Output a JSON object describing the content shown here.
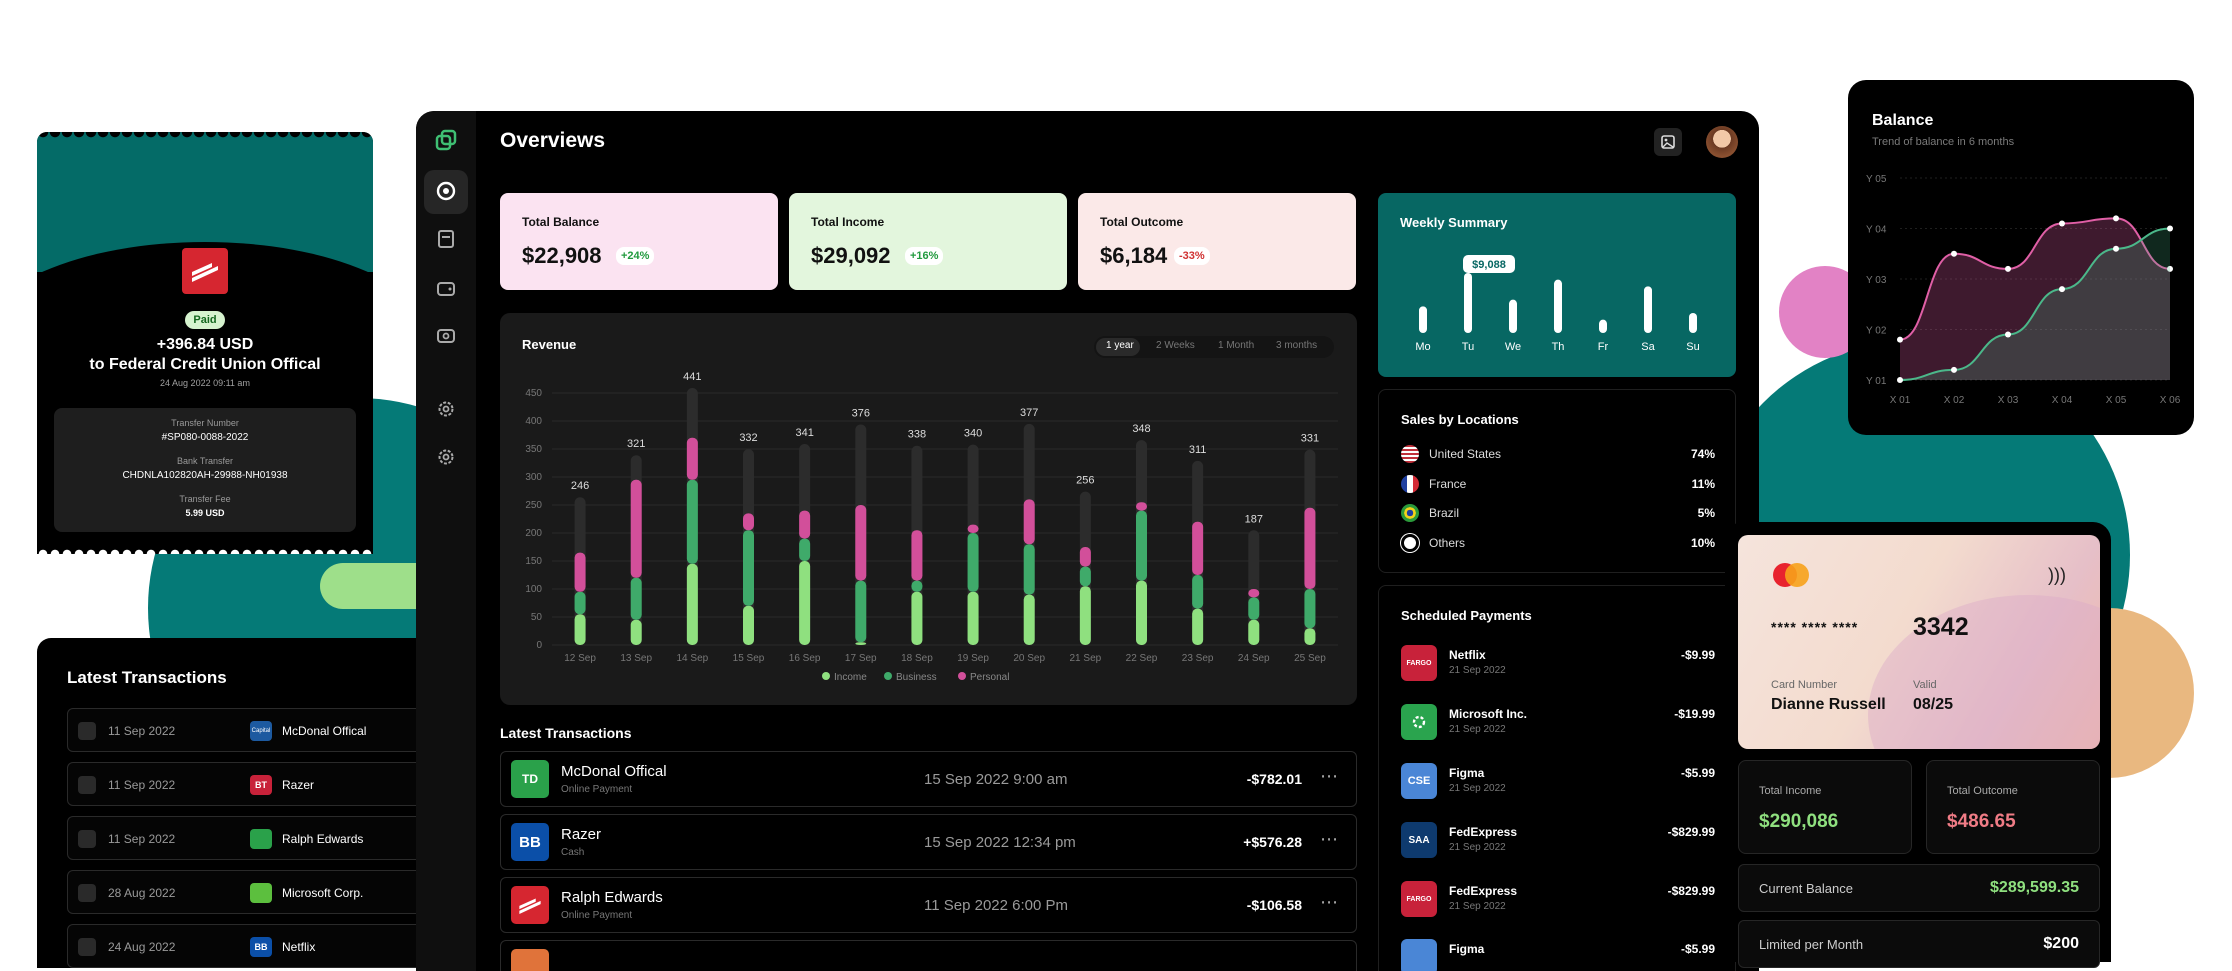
{
  "receipt": {
    "status": "Paid",
    "amount": "+396.84 USD",
    "to": "to  Federal Credit Union Offical",
    "date": "24 Aug 2022 09:11 am",
    "transfer_number_label": "Transfer Number",
    "transfer_number": "#SP080-0088-2022",
    "bank_transfer_label": "Bank Transfer",
    "bank_transfer": "CHDNLA102820AH-29988-NH01938",
    "fee_label": "Transfer Fee",
    "fee": "5.99 USD"
  },
  "left_transactions": {
    "title": "Latest Transactions",
    "rows": [
      {
        "date": "11 Sep 2022",
        "name": "McDonal Offical",
        "logo": "Capital"
      },
      {
        "date": "11 Sep 2022",
        "name": "Razer",
        "logo": "BT"
      },
      {
        "date": "11 Sep 2022",
        "name": "Ralph Edwards",
        "logo": "ralph"
      },
      {
        "date": "28 Aug 2022",
        "name": "Microsoft Corp.",
        "logo": "ms"
      },
      {
        "date": "24 Aug 2022",
        "name": "Netflix",
        "logo": "BB"
      }
    ]
  },
  "header": {
    "title": "Overviews"
  },
  "cards": [
    {
      "label": "Total Balance",
      "value": "$22,908",
      "badge": "+24%"
    },
    {
      "label": "Total Income",
      "value": "$29,092",
      "badge": "+16%"
    },
    {
      "label": "Total Outcome",
      "value": "$6,184",
      "badge": "-33%"
    }
  ],
  "revenue": {
    "title": "Revenue",
    "tabs": [
      "1 year",
      "2 Weeks",
      "1 Month",
      "3 months"
    ],
    "active_tab": "1 year"
  },
  "chart_data": [
    {
      "type": "bar",
      "title": "Revenue",
      "categories": [
        "12 Sep",
        "13 Sep",
        "14 Sep",
        "15 Sep",
        "16 Sep",
        "17 Sep",
        "18 Sep",
        "19 Sep",
        "20 Sep",
        "21 Sep",
        "22 Sep",
        "23 Sep",
        "24 Sep",
        "25 Sep"
      ],
      "totals": [
        246,
        321,
        441,
        332,
        341,
        376,
        338,
        340,
        377,
        256,
        348,
        311,
        187,
        331
      ],
      "series": [
        {
          "name": "Income",
          "color": "#8fe07f",
          "values": [
            55,
            45,
            145,
            70,
            150,
            5,
            95,
            95,
            90,
            105,
            115,
            65,
            45,
            30
          ]
        },
        {
          "name": "Business",
          "color": "#3faa6a",
          "values": [
            40,
            75,
            150,
            135,
            40,
            110,
            20,
            105,
            90,
            35,
            125,
            60,
            40,
            70
          ]
        },
        {
          "name": "Personal",
          "color": "#d24f9a",
          "values": [
            70,
            175,
            75,
            30,
            50,
            135,
            90,
            15,
            80,
            35,
            15,
            95,
            15,
            145
          ]
        }
      ],
      "ylim": [
        0,
        450
      ],
      "yticks": [
        0,
        50,
        100,
        150,
        200,
        250,
        300,
        350,
        400,
        450
      ]
    },
    {
      "type": "bar",
      "title": "Weekly Summary",
      "categories": [
        "Mo",
        "Tu",
        "We",
        "Th",
        "Fr",
        "Sa",
        "Su"
      ],
      "values": [
        4,
        9,
        5,
        8,
        2,
        7,
        3
      ],
      "highlight": {
        "category": "Tu",
        "label": "$9,088"
      }
    },
    {
      "type": "area",
      "title": "Balance",
      "subtitle": "Trend of balance in 6 months",
      "categories": [
        "X 01",
        "X 02",
        "X 03",
        "X 04",
        "X 05",
        "X 06"
      ],
      "yticks": [
        "Y 01",
        "Y 02",
        "Y 03",
        "Y 04",
        "Y 05"
      ],
      "series": [
        {
          "color": "#e05fa6",
          "values": [
            1.8,
            3.5,
            3.2,
            4.1,
            4.2,
            3.2
          ]
        },
        {
          "color": "#4bb88a",
          "values": [
            1.0,
            1.2,
            1.9,
            2.8,
            3.6,
            4.0
          ]
        }
      ]
    }
  ],
  "weekly": {
    "title": "Weekly Summary"
  },
  "locations": {
    "title": "Sales by Locations",
    "items": [
      {
        "name": "United States",
        "pct": "74%"
      },
      {
        "name": "France",
        "pct": "11%"
      },
      {
        "name": "Brazil",
        "pct": "5%"
      },
      {
        "name": "Others",
        "pct": "10%"
      }
    ]
  },
  "scheduled": {
    "title": "Scheduled Payments",
    "items": [
      {
        "name": "Netflix",
        "date": "21 Sep 2022",
        "amount": "-$9.99",
        "logo": "FARGO"
      },
      {
        "name": "Microsoft Inc.",
        "date": "21 Sep 2022",
        "amount": "-$19.99",
        "logo": ""
      },
      {
        "name": "Figma",
        "date": "21 Sep 2022",
        "amount": "-$5.99",
        "logo": "CSE"
      },
      {
        "name": "FedExpress",
        "date": "21 Sep 2022",
        "amount": "-$829.99",
        "logo": "SAA"
      },
      {
        "name": "FedExpress",
        "date": "21 Sep 2022",
        "amount": "-$829.99",
        "logo": "FARGO"
      },
      {
        "name": "Figma",
        "date": "",
        "amount": "-$5.99",
        "logo": ""
      }
    ]
  },
  "transactions": {
    "title": "Latest Transactions",
    "rows": [
      {
        "name": "McDonal Offical",
        "type": "Online Payment",
        "date": "15 Sep 2022 9:00 am",
        "amount": "-$782.01",
        "logo": "TD"
      },
      {
        "name": "Razer",
        "type": "Cash",
        "date": "15 Sep 2022 12:34 pm",
        "amount": "+$576.28",
        "logo": "BB"
      },
      {
        "name": "Ralph Edwards",
        "type": "Online Payment",
        "date": "11 Sep 2022 6:00 Pm",
        "amount": "-$106.58",
        "logo": ""
      }
    ]
  },
  "balance": {
    "title": "Balance",
    "subtitle": "Trend of balance in 6 months"
  },
  "credit": {
    "masked": "**** **** ****",
    "last4": "3342",
    "number_label": "Card Number",
    "holder": "Dianne Russell",
    "valid_label": "Valid",
    "valid": "08/25",
    "income_label": "Total Income",
    "income": "$290,086",
    "outcome_label": "Total Outcome",
    "outcome": "$486.65",
    "balance_label": "Current Balance",
    "balance": "$289,599.35",
    "limit_label": "Limited per Month",
    "limit": "$200"
  },
  "colors": {
    "accent": "#076763",
    "pink": "#d24f9a",
    "green": "#3faa6a",
    "light_green": "#8fe07f"
  }
}
